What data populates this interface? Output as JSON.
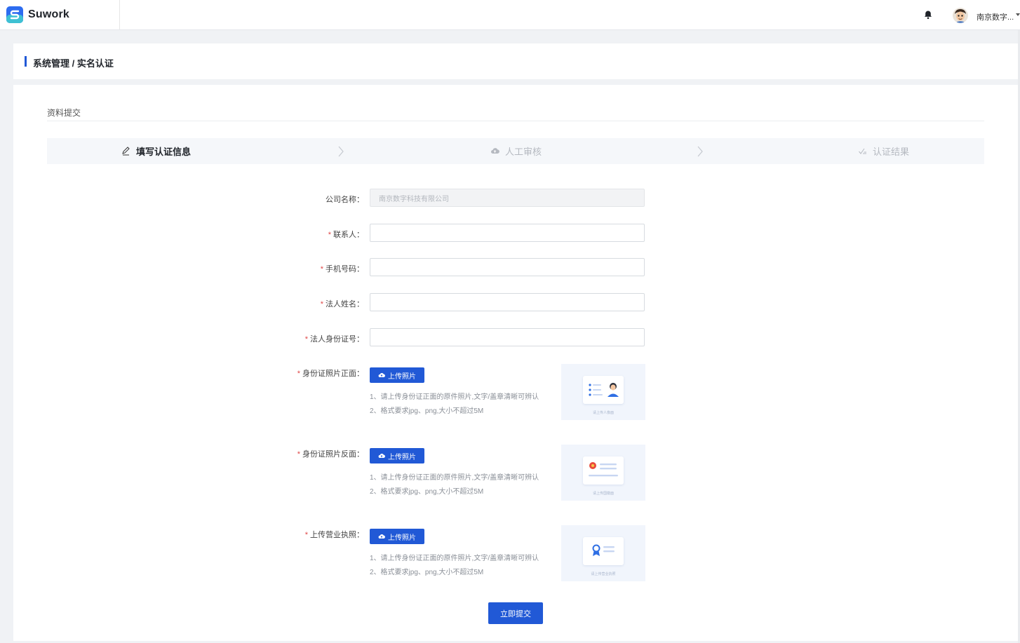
{
  "header": {
    "logo_text": "Suwork",
    "user_name": "南京数字..."
  },
  "breadcrumb": "系统管理 / 实名认证",
  "section_title": "资料提交",
  "steps": [
    {
      "label": "填写认证信息",
      "state": "active",
      "icon": "edit-icon"
    },
    {
      "label": "人工审核",
      "state": "inactive",
      "icon": "cloud-icon"
    },
    {
      "label": "认证结果",
      "state": "inactive",
      "icon": "check-icon"
    }
  ],
  "form": {
    "company_label": "公司名称：",
    "company_value": "南京数字科技有限公司",
    "contact_label": "联系人：",
    "phone_label": "手机号码：",
    "legal_name_label": "法人姓名：",
    "legal_id_label": "法人身份证号：",
    "required_mark": "*",
    "uploads": [
      {
        "label": "身份证照片正面：",
        "button": "上传照片",
        "tip1": "1、请上传身份证正面的原件照片,文字/盖章清晰可辨认",
        "tip2": "2、格式要求jpg、png,大小不超过5M",
        "sample_caption": "请上传人像面"
      },
      {
        "label": "身份证照片反面：",
        "button": "上传照片",
        "tip1": "1、请上传身份证正面的原件照片,文字/盖章清晰可辨认",
        "tip2": "2、格式要求jpg、png,大小不超过5M",
        "sample_caption": "请上传国徽面"
      },
      {
        "label": "上传营业执照：",
        "button": "上传照片",
        "tip1": "1、请上传身份证正面的原件照片,文字/盖章清晰可辨认",
        "tip2": "2、格式要求jpg、png,大小不超过5M",
        "sample_caption": "请上传营业执照"
      }
    ],
    "submit_label": "立即提交"
  },
  "colors": {
    "primary": "#2159d6",
    "required": "#e04848"
  }
}
